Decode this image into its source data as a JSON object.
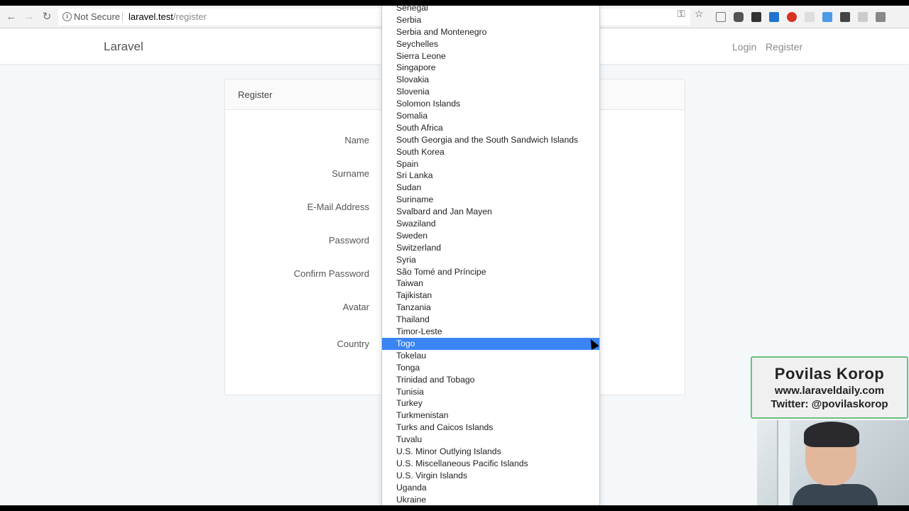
{
  "browser": {
    "security_label": "Not Secure",
    "url_host": "laravel.test",
    "url_path": "/register",
    "icons": [
      "back-icon",
      "forward-icon",
      "reload-icon",
      "info-icon",
      "key-icon",
      "star-icon"
    ]
  },
  "navbar": {
    "brand": "Laravel",
    "login": "Login",
    "register": "Register"
  },
  "card": {
    "title": "Register",
    "labels": {
      "name": "Name",
      "surname": "Surname",
      "email": "E-Mail Address",
      "password": "Password",
      "confirm_password": "Confirm Password",
      "avatar": "Avatar",
      "country": "Country"
    }
  },
  "dropdown": {
    "selected": "Togo",
    "options": [
      "Senegal",
      "Serbia",
      "Serbia and Montenegro",
      "Seychelles",
      "Sierra Leone",
      "Singapore",
      "Slovakia",
      "Slovenia",
      "Solomon Islands",
      "Somalia",
      "South Africa",
      "South Georgia and the South Sandwich Islands",
      "South Korea",
      "Spain",
      "Sri Lanka",
      "Sudan",
      "Suriname",
      "Svalbard and Jan Mayen",
      "Swaziland",
      "Sweden",
      "Switzerland",
      "Syria",
      "São Tomé and Príncipe",
      "Taiwan",
      "Tajikistan",
      "Tanzania",
      "Thailand",
      "Timor-Leste",
      "Togo",
      "Tokelau",
      "Tonga",
      "Trinidad and Tobago",
      "Tunisia",
      "Turkey",
      "Turkmenistan",
      "Turks and Caicos Islands",
      "Tuvalu",
      "U.S. Minor Outlying Islands",
      "U.S. Miscellaneous Pacific Islands",
      "U.S. Virgin Islands",
      "Uganda",
      "Ukraine"
    ]
  },
  "overlay": {
    "name": "Povilas Korop",
    "website": "www.laraveldaily.com",
    "twitter": "Twitter: @povilaskorop"
  }
}
